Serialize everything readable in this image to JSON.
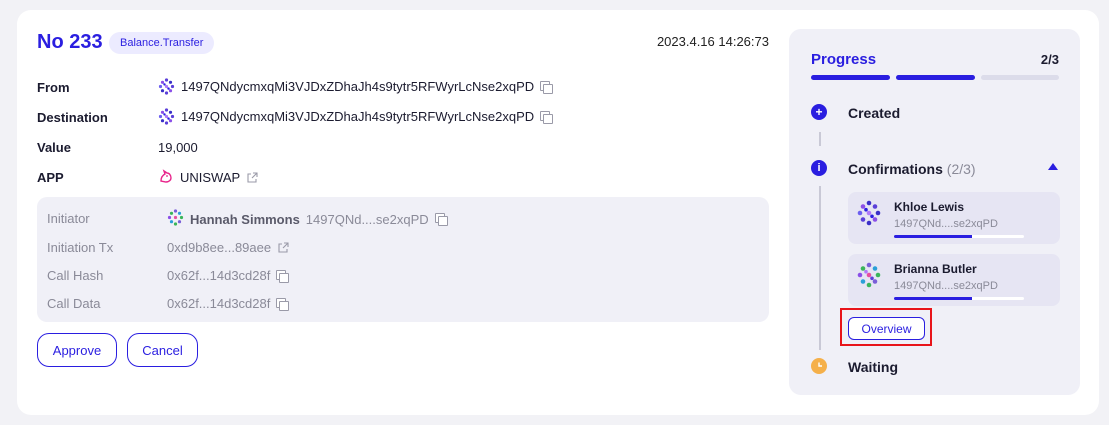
{
  "header": {
    "title": "No 233",
    "badge": "Balance.Transfer",
    "timestamp": "2023.4.16  14:26:73"
  },
  "details": [
    {
      "label": "From",
      "value": "1497QNdycmxqMi3VJDxZDhaJh4s9tytr5RFWyrLcNse2xqPD"
    },
    {
      "label": "Destination",
      "value": "1497QNdycmxqMi3VJDxZDhaJh4s9tytr5RFWyrLcNse2xqPD"
    },
    {
      "label": "Value",
      "value": "19,000"
    },
    {
      "label": "APP",
      "value": "UNISWAP"
    }
  ],
  "info": {
    "initiator_label": "Initiator",
    "initiator_name": "Hannah Simmons",
    "initiator_addr": "1497QNd....se2xqPD",
    "tx_label": "Initiation Tx",
    "tx_value": "0xd9b8ee...89aee",
    "hash_label": "Call Hash",
    "hash_value": "0x62f...14d3cd28f",
    "data_label": "Call Data",
    "data_value": "0x62f...14d3cd28f"
  },
  "buttons": {
    "approve": "Approve",
    "cancel": "Cancel"
  },
  "progress": {
    "title": "Progress",
    "count": "2/3",
    "fraction": 0.667,
    "steps": {
      "created": "Created",
      "confirmations": "Confirmations",
      "confirmations_count": "(2/3)",
      "waiting": "Waiting"
    },
    "signers": [
      {
        "name": "Khloe Lewis",
        "addr": "1497QNd....se2xqPD",
        "progress": 0.6
      },
      {
        "name": "Brianna Butler",
        "addr": "1497QNd....se2xqPD",
        "progress": 0.6
      }
    ],
    "overview_label": "Overview"
  },
  "colors": {
    "accent": "#2a1ee0",
    "waiting": "#f5b04a",
    "highlight": "#e8141a"
  },
  "icons": {
    "address_avatar": "polkadot-identicon",
    "app_logo": "uniswap-unicorn-icon",
    "copy": "copy-icon",
    "external": "external-link-icon"
  }
}
